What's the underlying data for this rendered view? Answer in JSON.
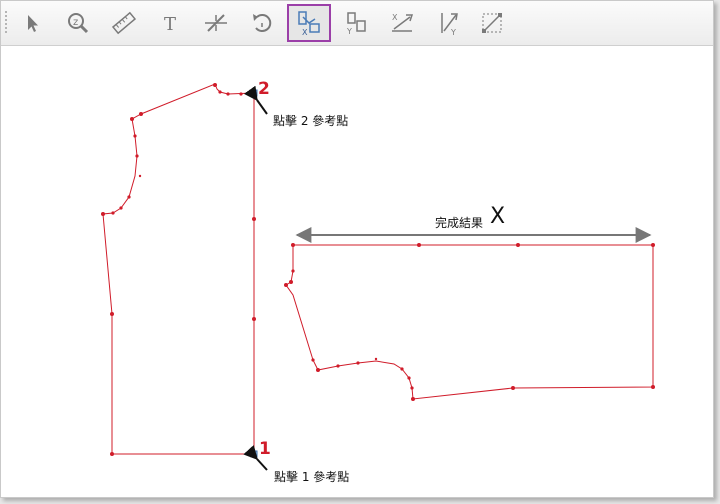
{
  "toolbar": {
    "tools": [
      {
        "name": "select-tool-button",
        "icon": "arrow-cursor-icon"
      },
      {
        "name": "zoom-tool-button",
        "icon": "magnifier-icon"
      },
      {
        "name": "measure-tool-button",
        "icon": "ruler-icon"
      },
      {
        "name": "text-tool-button",
        "icon": "text-T-icon",
        "glyph": "T"
      },
      {
        "name": "cut-tool-button",
        "icon": "slash-cut-icon"
      },
      {
        "name": "rotate-tool-button",
        "icon": "rotate-icon"
      },
      {
        "name": "align-x-tool-button",
        "icon": "align-x-icon",
        "active": true
      },
      {
        "name": "align-y-tool-button",
        "icon": "align-y-icon"
      },
      {
        "name": "flip-x-tool-button",
        "icon": "flip-x-icon"
      },
      {
        "name": "flip-y-tool-button",
        "icon": "flip-y-icon"
      },
      {
        "name": "diagonal-tool-button",
        "icon": "diagonal-icon"
      }
    ],
    "active_color": "#9b3fa8"
  },
  "canvas": {
    "point2_number": "2",
    "point2_label": "點擊 2 參考點",
    "point1_number": "1",
    "point1_label": "點擊 1 參考點",
    "result_label": "完成結果",
    "result_x": "X",
    "line_color": "#d01c2a"
  }
}
